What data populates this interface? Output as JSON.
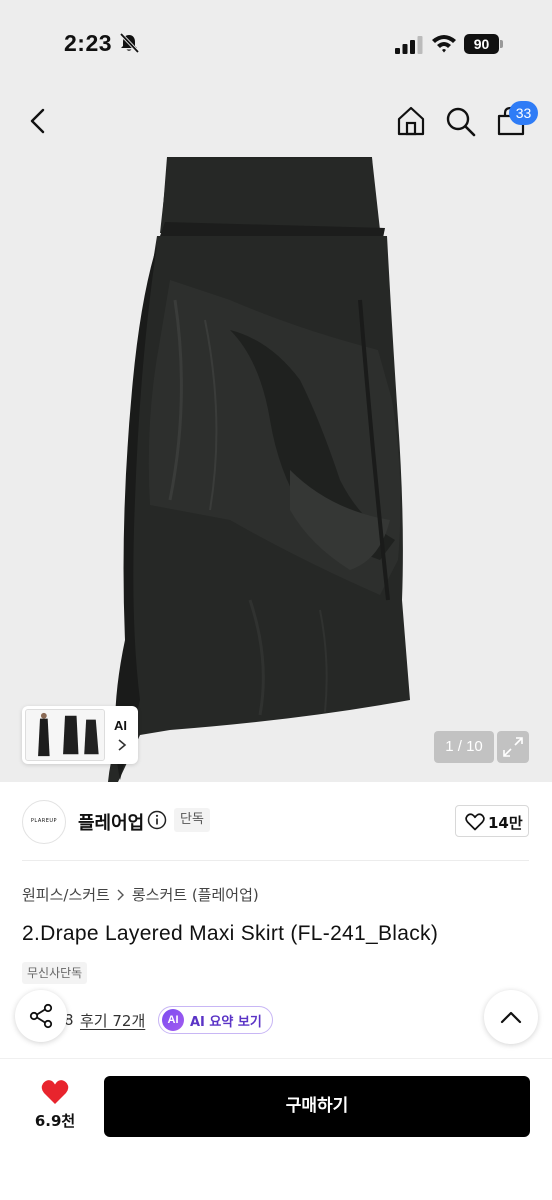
{
  "status_bar": {
    "time": "2:23",
    "battery": "90"
  },
  "nav": {
    "cart_count": "33"
  },
  "gallery": {
    "counter": "1 / 10",
    "thumb_label": "AI"
  },
  "brand": {
    "logo_text": "PLAREUP",
    "name": "플레어업",
    "tag": "단독",
    "like_count": "14만"
  },
  "breadcrumb": {
    "category": "원피스/스커트",
    "subcategory": "롱스커트 (플레어업)"
  },
  "product": {
    "title": "2.Drape Layered Maxi Skirt (FL-241_Black)",
    "exclusive_tag": "무신사단독",
    "rating_digit": "8",
    "review_text": "후기 72개",
    "ai_badge": "AI",
    "ai_summary_label": "AI 요약 보기"
  },
  "bottom_bar": {
    "wish_count": "6.9천",
    "buy_label": "구매하기"
  },
  "colors": {
    "accent_blue": "#2f7cf6",
    "heart_red": "#e8242d",
    "ai_purple": "#7b4cf0",
    "button_black": "#000000"
  },
  "icons": [
    "bell-slash-icon",
    "signal-icon",
    "wifi-icon",
    "back-icon",
    "home-icon",
    "search-icon",
    "cart-icon",
    "expand-icon",
    "info-icon",
    "heart-icon",
    "share-icon",
    "chevron-up-icon"
  ]
}
